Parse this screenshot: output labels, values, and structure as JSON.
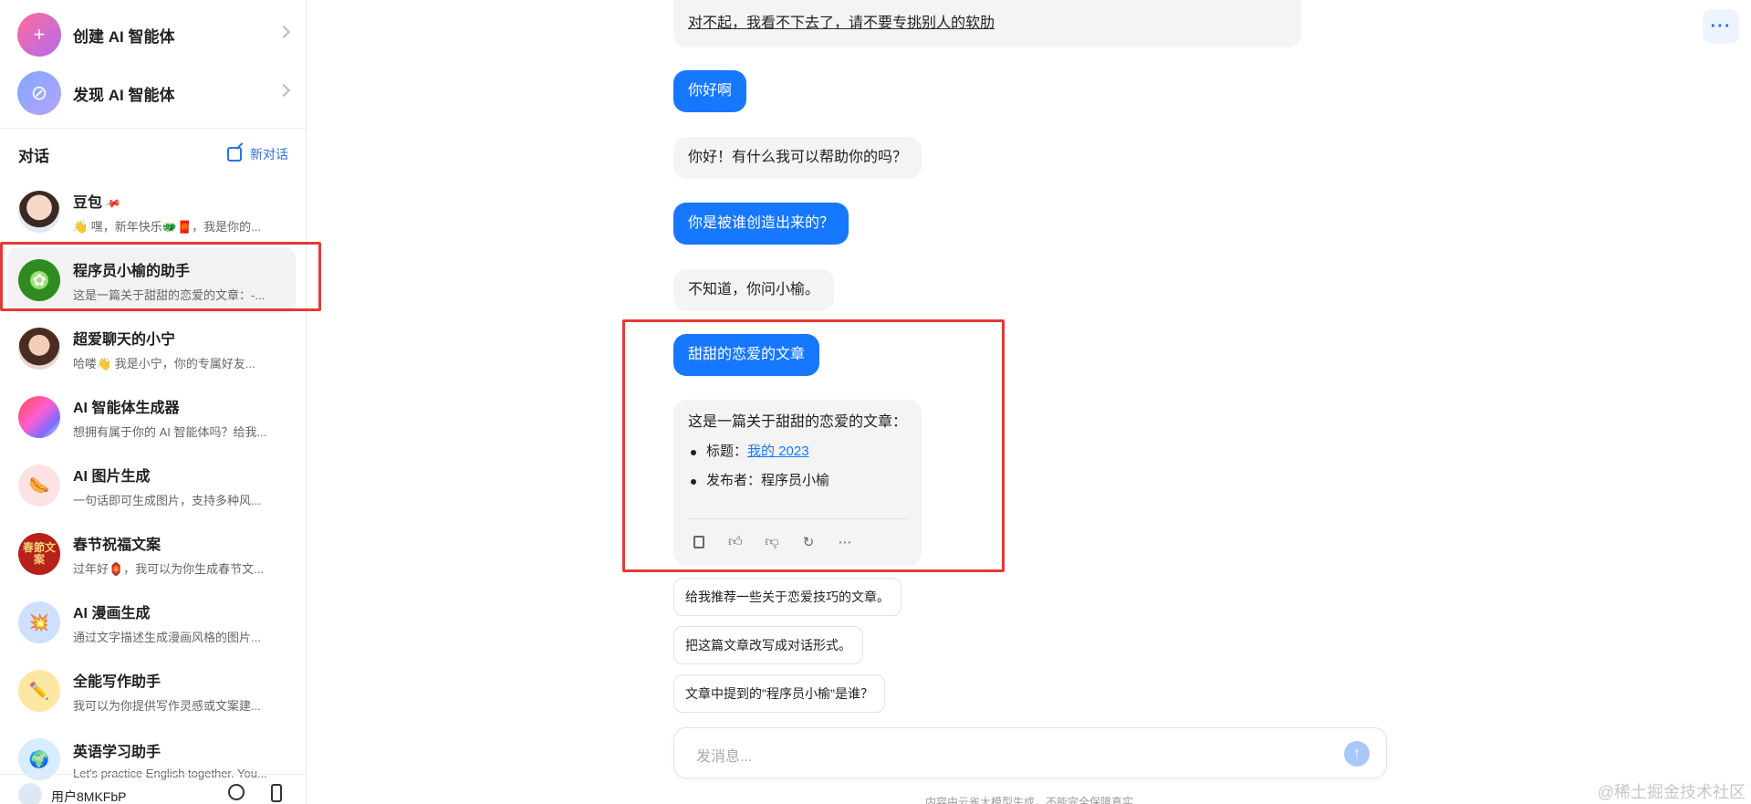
{
  "sidebar": {
    "top_items": [
      {
        "label": "创建 AI 智能体",
        "icon": "plus-icon"
      },
      {
        "label": "发现 AI 智能体",
        "icon": "compass-icon"
      }
    ],
    "conversations_title": "对话",
    "new_chat_label": "新对话",
    "conversations": [
      {
        "name": "豆包",
        "preview": "👋 嘿，新年快乐🐲🧧，我是你的...",
        "pinned": true,
        "avatar": "doubao-avatar"
      },
      {
        "name": "程序员小榆的助手",
        "preview": "这是一篇关于甜甜的恋爱的文章：-...",
        "active": true,
        "avatar": "plant-avatar"
      },
      {
        "name": "超爱聊天的小宁",
        "preview": "哈喽👋 我是小宁，你的专属好友...",
        "avatar": "girl-avatar"
      },
      {
        "name": "AI 智能体生成器",
        "preview": "想拥有属于你的 AI 智能体吗？给我...",
        "avatar": "gradient-orb-avatar"
      },
      {
        "name": "AI 图片生成",
        "preview": "一句话即可生成图片，支持多种风...",
        "avatar": "image-gen-avatar"
      },
      {
        "name": "春节祝福文案",
        "preview": "过年好🏮，我可以为你生成春节文...",
        "avatar": "spring-festival-avatar",
        "avatar_text": "春節文案"
      },
      {
        "name": "AI 漫画生成",
        "preview": "通过文字描述生成漫画风格的图片...",
        "avatar": "comic-avatar"
      },
      {
        "name": "全能写作助手",
        "preview": "我可以为你提供写作灵感或文案建...",
        "avatar": "pencil-avatar"
      },
      {
        "name": "英语学习助手",
        "preview": "Let's practice English together. You...",
        "avatar": "globe-avatar"
      }
    ],
    "user_name": "用户8MKFbP"
  },
  "chat": {
    "messages": [
      {
        "role": "bot",
        "text": "对不起，我看不下去了，请不要专挑别人的软肋"
      },
      {
        "role": "user",
        "text": "你好啊"
      },
      {
        "role": "bot",
        "text": "你好！有什么我可以帮助你的吗？"
      },
      {
        "role": "user",
        "text": "你是被谁创造出来的？"
      },
      {
        "role": "bot",
        "text": "不知道，你问小榆。"
      },
      {
        "role": "user",
        "text": "甜甜的恋爱的文章"
      }
    ],
    "answer": {
      "lead": "这是一篇关于甜甜的恋爱的文章：",
      "title_label": "标题：",
      "title_link": "我的 2023",
      "author_label": "发布者：程序员小榆"
    },
    "suggestions": [
      "给我推荐一些关于恋爱技巧的文章。",
      "把这篇文章改写成对话形式。",
      "文章中提到的\"程序员小榆\"是谁？"
    ],
    "input_placeholder": "发消息...",
    "disclaimer": "内容由云雀大模型生成，不能完全保障真实"
  },
  "watermark": "@稀土掘金技术社区",
  "colors": {
    "accent": "#1677ff",
    "highlight": "#e53935"
  }
}
